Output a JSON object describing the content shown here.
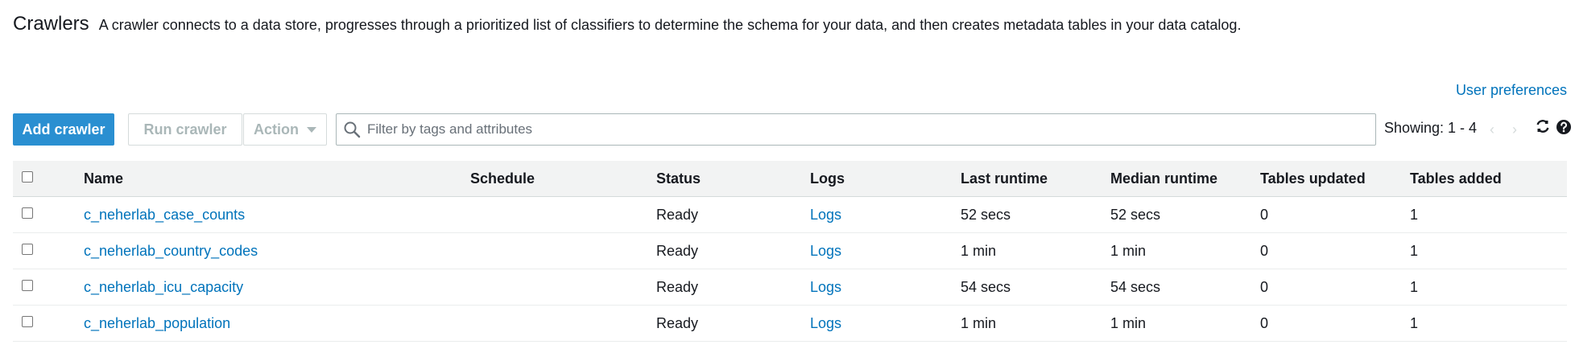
{
  "header": {
    "title": "Crawlers",
    "description": "A crawler connects to a data store, progresses through a prioritized list of classifiers to determine the schema for your data, and then creates metadata tables in your data catalog."
  },
  "user_preferences_label": "User preferences",
  "toolbar": {
    "add_label": "Add crawler",
    "run_label": "Run crawler",
    "action_label": "Action",
    "search_placeholder": "Filter by tags and attributes",
    "showing": "Showing: 1 - 4",
    "prev_glyph": "‹",
    "next_glyph": "›",
    "icons": [
      "search-icon",
      "chevron-left-icon",
      "chevron-right-icon",
      "refresh-icon",
      "help-icon"
    ]
  },
  "colors": {
    "primary": "#2a8fd1",
    "link": "#0073bb",
    "disabled": "#aab7b8",
    "header_bg": "#f2f3f3"
  },
  "table": {
    "columns": {
      "name": "Name",
      "schedule": "Schedule",
      "status": "Status",
      "logs": "Logs",
      "last_runtime": "Last runtime",
      "median_runtime": "Median runtime",
      "tables_updated": "Tables updated",
      "tables_added": "Tables added"
    },
    "rows": [
      {
        "name": "c_neherlab_case_counts",
        "schedule": "",
        "status": "Ready",
        "logs": "Logs",
        "last_runtime": "52 secs",
        "median_runtime": "52 secs",
        "tables_updated": "0",
        "tables_added": "1"
      },
      {
        "name": "c_neherlab_country_codes",
        "schedule": "",
        "status": "Ready",
        "logs": "Logs",
        "last_runtime": "1 min",
        "median_runtime": "1 min",
        "tables_updated": "0",
        "tables_added": "1"
      },
      {
        "name": "c_neherlab_icu_capacity",
        "schedule": "",
        "status": "Ready",
        "logs": "Logs",
        "last_runtime": "54 secs",
        "median_runtime": "54 secs",
        "tables_updated": "0",
        "tables_added": "1"
      },
      {
        "name": "c_neherlab_population",
        "schedule": "",
        "status": "Ready",
        "logs": "Logs",
        "last_runtime": "1 min",
        "median_runtime": "1 min",
        "tables_updated": "0",
        "tables_added": "1"
      }
    ]
  }
}
